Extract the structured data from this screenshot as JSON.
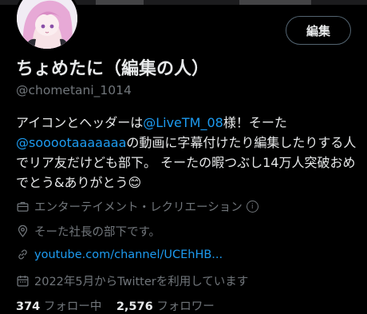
{
  "profile": {
    "display_name": "ちょめたに（編集の人）",
    "handle": "@chometani_1014",
    "edit_label": "編集",
    "bio": {
      "part1": "アイコンとヘッダーは",
      "mention1": "@LiveTM_08",
      "part2": "様！そーた",
      "mention2": "@sooootaaaaaaa",
      "part3": "の動画に字幕付けたり編集したりする人でリア友だけども部下。 そーたの暇つぶし14万人突破おめでとう&ありがとう",
      "emoji": "😊"
    },
    "category": "エンターテイメント・レクリエーション",
    "location": "そーた社長の部下です。",
    "website": "youtube.com/channel/UCEhHB...",
    "joined": "2022年5月からTwitterを利用しています",
    "following_count": "374",
    "following_label": "フォロー中",
    "followers_count": "2,576",
    "followers_label": "フォロワー"
  },
  "icons": {
    "category": "briefcase-icon",
    "location": "location-pin-icon",
    "website": "link-icon",
    "joined": "calendar-icon",
    "info": "info-icon"
  },
  "colors": {
    "background": "#000000",
    "text": "#e7e9ea",
    "secondary": "#71767b",
    "accent": "#1d9bf0"
  }
}
